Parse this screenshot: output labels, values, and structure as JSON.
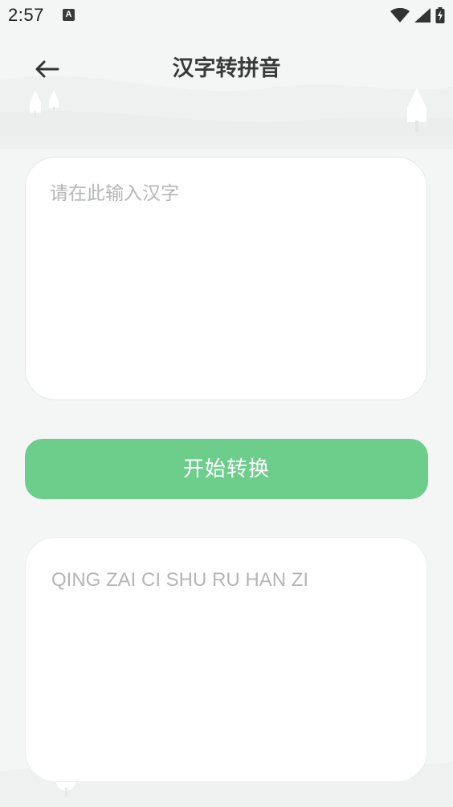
{
  "status_bar": {
    "time": "2:57",
    "notification_icon_letter": "A",
    "icons": [
      "wifi-icon",
      "signal-icon",
      "battery-charging-icon"
    ]
  },
  "header": {
    "title": "汉字转拼音",
    "back_icon": "arrow-left-icon"
  },
  "input": {
    "placeholder": "请在此输入汉字",
    "value": ""
  },
  "convert_button": {
    "label": "开始转换"
  },
  "output": {
    "text": "QING ZAI CI SHU RU HAN ZI"
  },
  "colors": {
    "background": "#f4f5f5",
    "accent": "#6dcd8b",
    "card": "#ffffff",
    "placeholder": "#b4b6b6",
    "title": "#3a3a3a"
  }
}
